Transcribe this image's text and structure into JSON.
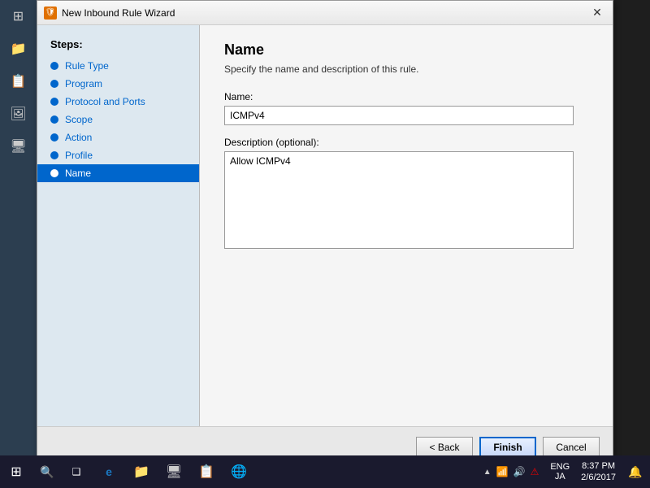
{
  "dialog": {
    "title": "New Inbound Rule Wizard",
    "title_icon": "🛡",
    "close_btn": "✕"
  },
  "heading": {
    "title": "Name",
    "subtitle": "Specify the name and description of this rule."
  },
  "steps": {
    "header": "Steps:",
    "items": [
      {
        "id": "rule-type",
        "label": "Rule Type",
        "active": false
      },
      {
        "id": "program",
        "label": "Program",
        "active": false
      },
      {
        "id": "protocol-ports",
        "label": "Protocol and Ports",
        "active": false
      },
      {
        "id": "scope",
        "label": "Scope",
        "active": false
      },
      {
        "id": "action",
        "label": "Action",
        "active": false
      },
      {
        "id": "profile",
        "label": "Profile",
        "active": false
      },
      {
        "id": "name",
        "label": "Name",
        "active": true
      }
    ]
  },
  "form": {
    "name_label": "Name:",
    "name_value": "ICMPv4",
    "name_placeholder": "",
    "description_label": "Description (optional):",
    "description_value": "Allow ICMPv4"
  },
  "buttons": {
    "back": "< Back",
    "finish": "Finish",
    "cancel": "Cancel"
  },
  "taskbar": {
    "start_icon": "⊞",
    "search_icon": "🔍",
    "task_view_icon": "❑",
    "time": "8:37 PM",
    "date": "2/6/2017",
    "lang1": "ENG",
    "lang2": "JA",
    "notification_icon": "🔔",
    "icons": [
      "🖥",
      "e",
      "📁",
      "🖥",
      "📋",
      "🌐"
    ]
  }
}
